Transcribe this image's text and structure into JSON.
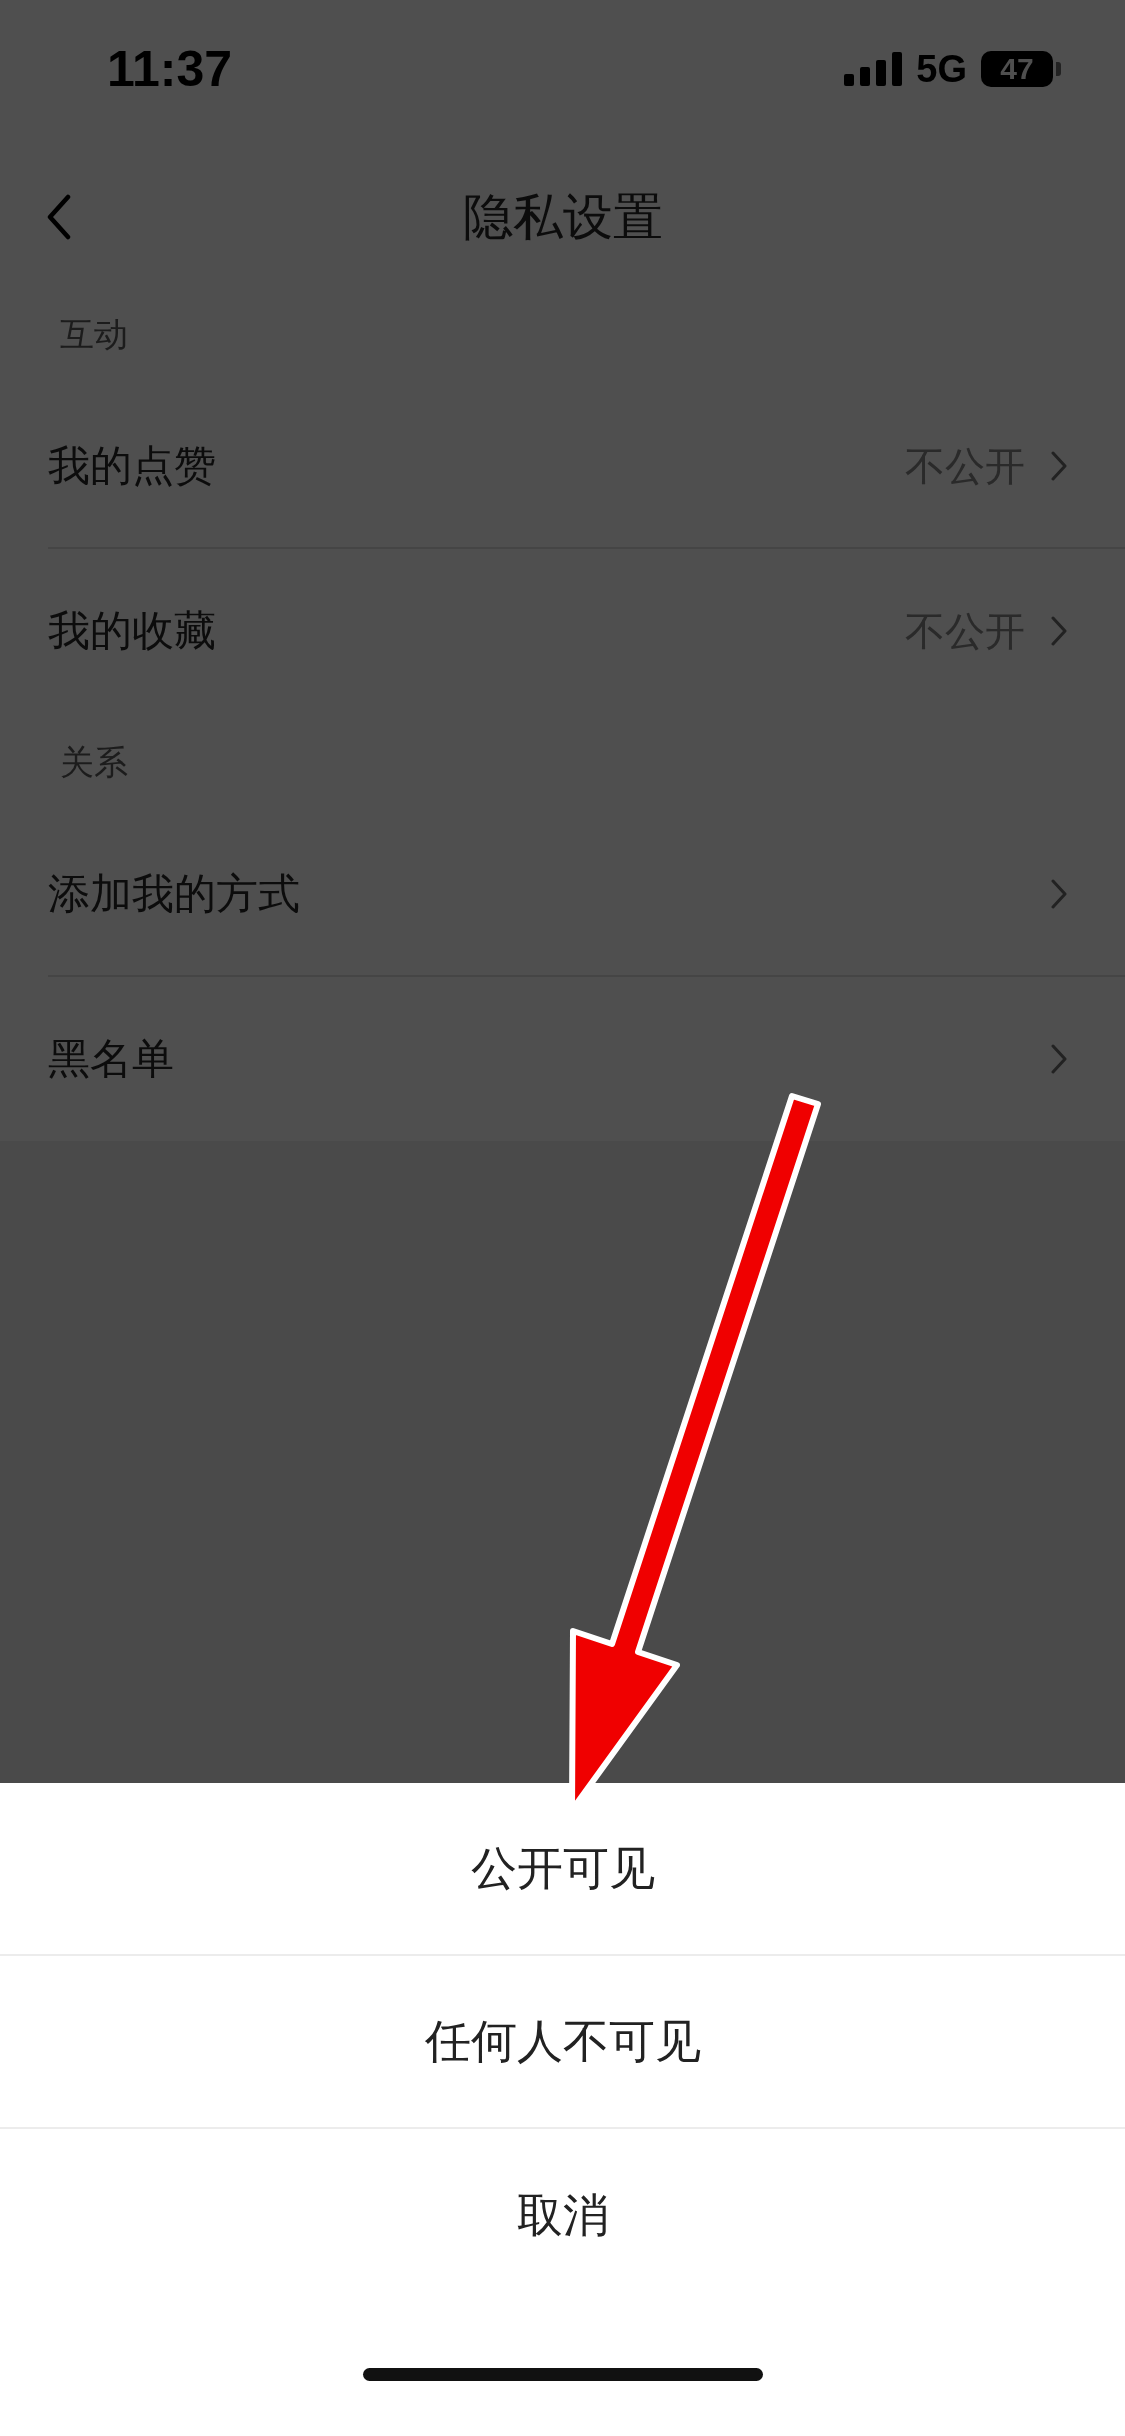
{
  "status_bar": {
    "time": "11:37",
    "network": "5G",
    "battery": "47"
  },
  "nav": {
    "title": "隐私设置"
  },
  "sections": [
    {
      "header": "互动",
      "rows": [
        {
          "label": "我的点赞",
          "value": "不公开"
        },
        {
          "label": "我的收藏",
          "value": "不公开"
        }
      ]
    },
    {
      "header": "关系",
      "rows": [
        {
          "label": "添加我的方式"
        },
        {
          "label": "黑名单"
        }
      ]
    }
  ],
  "action_sheet": {
    "options": [
      {
        "label": "公开可见"
      },
      {
        "label": "任何人不可见"
      },
      {
        "label": "取消"
      }
    ]
  }
}
